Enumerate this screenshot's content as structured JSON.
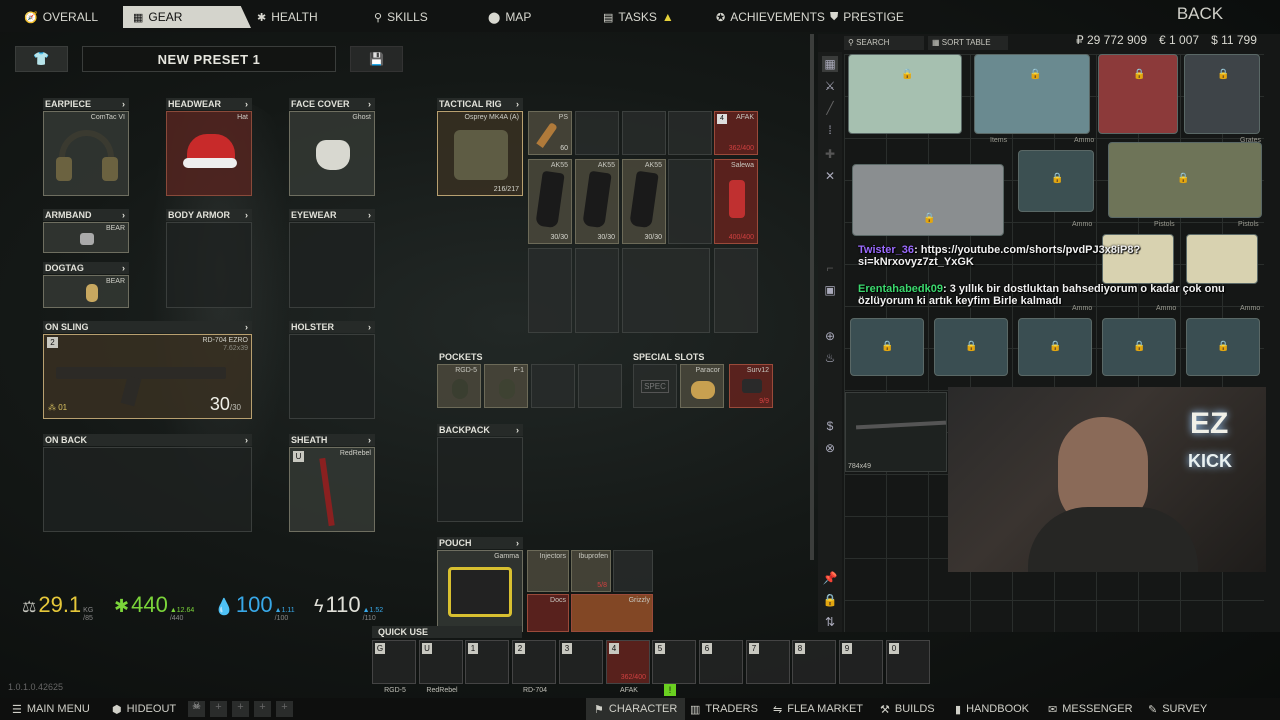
{
  "topnav": {
    "tabs": [
      {
        "label": "OVERALL",
        "icon": "overall-icon"
      },
      {
        "label": "GEAR",
        "icon": "gear-icon"
      },
      {
        "label": "HEALTH",
        "icon": "health-icon"
      },
      {
        "label": "SKILLS",
        "icon": "skills-icon"
      },
      {
        "label": "MAP",
        "icon": "map-icon"
      },
      {
        "label": "TASKS",
        "icon": "tasks-icon"
      },
      {
        "label": "ACHIEVEMENTS",
        "icon": "achievements-icon"
      },
      {
        "label": "PRESTIGE",
        "icon": "prestige-icon"
      }
    ],
    "active_tab": "GEAR",
    "back_label": "BACK"
  },
  "preset": {
    "name": "NEW PRESET 1"
  },
  "slots": {
    "earpiece": {
      "label": "EARPIECE",
      "item": "ComTac VI"
    },
    "headwear": {
      "label": "HEADWEAR",
      "item": "Hat"
    },
    "face_cover": {
      "label": "FACE COVER",
      "item": "Ghost"
    },
    "armband": {
      "label": "ARMBAND",
      "item": "BEAR"
    },
    "body_armor": {
      "label": "BODY ARMOR"
    },
    "eyewear": {
      "label": "EYEWEAR"
    },
    "dogtag": {
      "label": "DOGTAG",
      "item": "BEAR"
    },
    "on_sling": {
      "label": "ON SLING",
      "item": "RD-704 EZRO",
      "caliber": "7.62x39",
      "ammo": "30",
      "ammo_max": "/30",
      "count_badge": "2",
      "fire_mode": "01"
    },
    "holster": {
      "label": "HOLSTER"
    },
    "on_back": {
      "label": "ON BACK"
    },
    "sheath": {
      "label": "SHEATH",
      "item": "RedRebel",
      "badge": "U"
    },
    "tactical_rig": {
      "label": "TACTICAL RIG",
      "item": "Osprey MK4A (A)",
      "durability": "216/217"
    },
    "pockets": {
      "label": "POCKETS"
    },
    "special_slots": {
      "label": "SPECIAL SLOTS"
    },
    "backpack": {
      "label": "BACKPACK"
    },
    "pouch": {
      "label": "POUCH",
      "item": "Gamma"
    }
  },
  "rig_items": [
    {
      "name": "PS",
      "count": "60"
    },
    {
      "name": "AFAK",
      "count": "362/400",
      "badge": "4"
    },
    {
      "name": "AK55",
      "count": "30/30"
    },
    {
      "name": "AK55",
      "count": "30/30"
    },
    {
      "name": "AK55",
      "count": "30/30"
    },
    {
      "name": "Salewa",
      "count": "400/400"
    }
  ],
  "pocket_items": [
    {
      "name": "RGD-5"
    },
    {
      "name": "F-1"
    }
  ],
  "special_items": [
    {
      "name": "SPEC"
    },
    {
      "name": "Paracor"
    },
    {
      "name": "Surv12",
      "count": "9/9"
    }
  ],
  "pouch_items": [
    {
      "name": "Injectors"
    },
    {
      "name": "Ibuprofen",
      "count": "5/8"
    },
    {
      "name": "Docs"
    },
    {
      "name": "Grizzly"
    }
  ],
  "stats": {
    "weight": "29.1",
    "weight_unit": "KG",
    "weight_max": "/85",
    "energy": "440",
    "energy_max": "/440",
    "energy_rate": "▲12.64",
    "hydration": "100",
    "hydration_max": "/100",
    "hydration_rate": "▲1.11",
    "health": "110",
    "health_max": "/110",
    "health_rate": "▲1.52"
  },
  "quick_use": {
    "label": "QUICK USE",
    "slots": [
      {
        "key": "G",
        "name": "RGD-5"
      },
      {
        "key": "U",
        "name": "RedRebel"
      },
      {
        "key": "1",
        "name": ""
      },
      {
        "key": "2",
        "name": "RD-704"
      },
      {
        "key": "3",
        "name": ""
      },
      {
        "key": "4",
        "name": "AFAK",
        "count": "362/400"
      },
      {
        "key": "5",
        "name": ""
      },
      {
        "key": "6",
        "name": ""
      },
      {
        "key": "7",
        "name": ""
      },
      {
        "key": "8",
        "name": ""
      },
      {
        "key": "9",
        "name": ""
      },
      {
        "key": "0",
        "name": ""
      }
    ]
  },
  "version": "1.0.1.0.42625",
  "bottomnav": [
    {
      "label": "MAIN MENU",
      "icon": "menu-icon"
    },
    {
      "label": "HIDEOUT",
      "icon": "hideout-icon"
    },
    {
      "label": "CHARACTER",
      "icon": "character-icon"
    },
    {
      "label": "TRADERS",
      "icon": "traders-icon"
    },
    {
      "label": "FLEA MARKET",
      "icon": "flea-market-icon"
    },
    {
      "label": "BUILDS",
      "icon": "builds-icon"
    },
    {
      "label": "HANDBOOK",
      "icon": "handbook-icon"
    },
    {
      "label": "MESSENGER",
      "icon": "messenger-icon"
    },
    {
      "label": "SURVEY",
      "icon": "survey-icon"
    }
  ],
  "stash": {
    "search_label": "SEARCH",
    "sort_label": "SORT TABLE",
    "roubles": "₽ 29 772 909",
    "euros": "€ 1 007",
    "dollars": "$ 11 799",
    "case_labels": [
      "Items",
      "Ammo",
      "Grates",
      "Ammo",
      "Pistols",
      "Pistols",
      "Ammo",
      "Ammo",
      "Ammo"
    ],
    "item_size": "784x49"
  },
  "chat": [
    {
      "user": "Twister_36",
      "text": ": https://youtube.com/shorts/pvdPJ3x8iP8?si=kNrxovyz7zt_YxGK",
      "color": "#9b6bff"
    },
    {
      "user": "Erentahabedk09",
      "text": ": 3 yıllık bir dostluktan bahsediyorum o kadar çok onu özlüyorum ki artık keyfim Birle kalmadı",
      "color": "#3cd86e"
    }
  ],
  "overlay": {
    "line1": "EZ",
    "line2": "KICK"
  },
  "colors": {
    "accent": "#d4d4cc",
    "warn": "#e6d23a",
    "danger": "#d04040",
    "energy": "#7bd43a",
    "hydration": "#38a8e8"
  }
}
